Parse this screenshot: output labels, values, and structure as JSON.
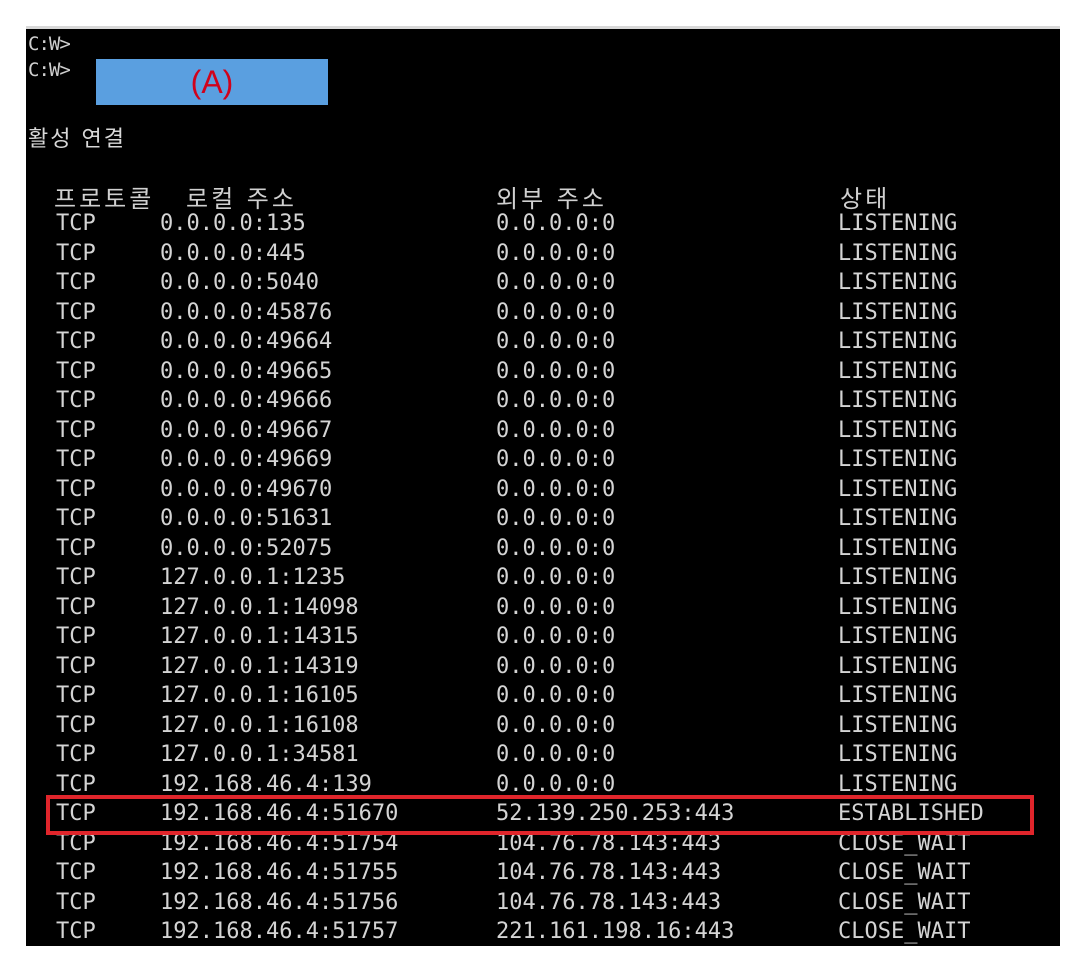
{
  "prompts": {
    "line1": "C:W>",
    "line2": "C:W>"
  },
  "command": {
    "label": "(A)",
    "box_color": "#5a9fe0",
    "label_color": "#d0021b"
  },
  "section_title": "활성 연결",
  "table": {
    "headers": {
      "protocol": "프로토콜",
      "local": "로컬 주소",
      "foreign": "외부 주소",
      "state": "상태"
    },
    "rows": [
      {
        "protocol": "TCP",
        "local": "0.0.0.0:135",
        "foreign": "0.0.0.0:0",
        "state": "LISTENING"
      },
      {
        "protocol": "TCP",
        "local": "0.0.0.0:445",
        "foreign": "0.0.0.0:0",
        "state": "LISTENING"
      },
      {
        "protocol": "TCP",
        "local": "0.0.0.0:5040",
        "foreign": "0.0.0.0:0",
        "state": "LISTENING"
      },
      {
        "protocol": "TCP",
        "local": "0.0.0.0:45876",
        "foreign": "0.0.0.0:0",
        "state": "LISTENING"
      },
      {
        "protocol": "TCP",
        "local": "0.0.0.0:49664",
        "foreign": "0.0.0.0:0",
        "state": "LISTENING"
      },
      {
        "protocol": "TCP",
        "local": "0.0.0.0:49665",
        "foreign": "0.0.0.0:0",
        "state": "LISTENING"
      },
      {
        "protocol": "TCP",
        "local": "0.0.0.0:49666",
        "foreign": "0.0.0.0:0",
        "state": "LISTENING"
      },
      {
        "protocol": "TCP",
        "local": "0.0.0.0:49667",
        "foreign": "0.0.0.0:0",
        "state": "LISTENING"
      },
      {
        "protocol": "TCP",
        "local": "0.0.0.0:49669",
        "foreign": "0.0.0.0:0",
        "state": "LISTENING"
      },
      {
        "protocol": "TCP",
        "local": "0.0.0.0:49670",
        "foreign": "0.0.0.0:0",
        "state": "LISTENING"
      },
      {
        "protocol": "TCP",
        "local": "0.0.0.0:51631",
        "foreign": "0.0.0.0:0",
        "state": "LISTENING"
      },
      {
        "protocol": "TCP",
        "local": "0.0.0.0:52075",
        "foreign": "0.0.0.0:0",
        "state": "LISTENING"
      },
      {
        "protocol": "TCP",
        "local": "127.0.0.1:1235",
        "foreign": "0.0.0.0:0",
        "state": "LISTENING"
      },
      {
        "protocol": "TCP",
        "local": "127.0.0.1:14098",
        "foreign": "0.0.0.0:0",
        "state": "LISTENING"
      },
      {
        "protocol": "TCP",
        "local": "127.0.0.1:14315",
        "foreign": "0.0.0.0:0",
        "state": "LISTENING"
      },
      {
        "protocol": "TCP",
        "local": "127.0.0.1:14319",
        "foreign": "0.0.0.0:0",
        "state": "LISTENING"
      },
      {
        "protocol": "TCP",
        "local": "127.0.0.1:16105",
        "foreign": "0.0.0.0:0",
        "state": "LISTENING"
      },
      {
        "protocol": "TCP",
        "local": "127.0.0.1:16108",
        "foreign": "0.0.0.0:0",
        "state": "LISTENING"
      },
      {
        "protocol": "TCP",
        "local": "127.0.0.1:34581",
        "foreign": "0.0.0.0:0",
        "state": "LISTENING"
      },
      {
        "protocol": "TCP",
        "local": "192.168.46.4:139",
        "foreign": "0.0.0.0:0",
        "state": "LISTENING"
      },
      {
        "protocol": "TCP",
        "local": "192.168.46.4:51670",
        "foreign": "52.139.250.253:443",
        "state": "ESTABLISHED"
      },
      {
        "protocol": "TCP",
        "local": "192.168.46.4:51754",
        "foreign": "104.76.78.143:443",
        "state": "CLOSE_WAIT"
      },
      {
        "protocol": "TCP",
        "local": "192.168.46.4:51755",
        "foreign": "104.76.78.143:443",
        "state": "CLOSE_WAIT"
      },
      {
        "protocol": "TCP",
        "local": "192.168.46.4:51756",
        "foreign": "104.76.78.143:443",
        "state": "CLOSE_WAIT"
      },
      {
        "protocol": "TCP",
        "local": "192.168.46.4:51757",
        "foreign": "221.161.198.16:443",
        "state": "CLOSE_WAIT"
      }
    ]
  },
  "highlight": {
    "row_index": 20,
    "color": "#e0252b"
  }
}
